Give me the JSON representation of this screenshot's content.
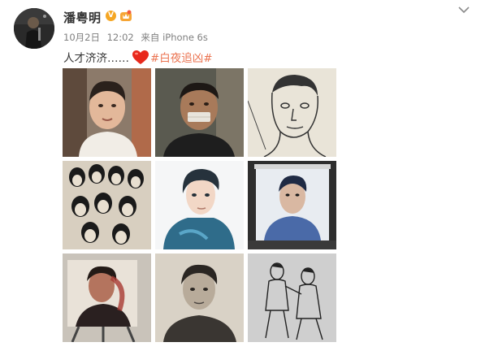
{
  "post": {
    "username": "潘粤明",
    "verified_badge": "V",
    "date": "10月2日",
    "time": "12:02",
    "source_prefix": "来自",
    "source": "iPhone 6s",
    "text": "人才济济……",
    "hashtag": "#白夜追凶#"
  },
  "icons": {
    "expand": "chevron-down-icon",
    "heart": "heart-emoji-icon",
    "verified": "verified-v-icon",
    "vip": "vip-crown-icon"
  },
  "colors": {
    "hashtag": "#eb7350",
    "verified_badge": "#f5a623",
    "meta_text": "#808080",
    "username": "#333333"
  },
  "gallery": {
    "images": [
      {
        "name": "realistic-portrait-painting"
      },
      {
        "name": "bandaged-portrait-painting"
      },
      {
        "name": "line-sketch-portrait"
      },
      {
        "name": "group-ink-drawing"
      },
      {
        "name": "anime-style-portrait"
      },
      {
        "name": "watercolor-portrait-on-easel"
      },
      {
        "name": "painted-portrait-on-easel"
      },
      {
        "name": "pencil-portrait"
      },
      {
        "name": "two-figure-sketch"
      }
    ]
  }
}
